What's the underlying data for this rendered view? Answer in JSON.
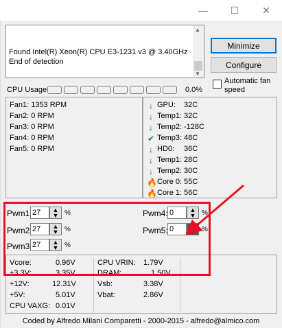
{
  "window": {
    "minimize_glyph": "—",
    "maximize_glyph": "☐",
    "close_glyph": "✕"
  },
  "log": {
    "lines": [
      "Found Intel(R) Xeon(R) CPU E3-1231 v3 @ 3.40GHz",
      "End of detection"
    ]
  },
  "buttons": {
    "minimize": "Minimize",
    "configure": "Configure"
  },
  "auto_fan": {
    "label": "Automatic fan speed",
    "checked": false
  },
  "cpu_usage": {
    "label": "CPU Usage",
    "value": "0.0%"
  },
  "fans": [
    {
      "label": "Fan1:",
      "value": "1353 RPM"
    },
    {
      "label": "Fan2:",
      "value": "0 RPM"
    },
    {
      "label": "Fan3:",
      "value": "0 RPM"
    },
    {
      "label": "Fan4:",
      "value": "0 RPM"
    },
    {
      "label": "Fan5:",
      "value": "0 RPM"
    }
  ],
  "temps": [
    {
      "icon": "down-arrow-icon",
      "label": "GPU:",
      "value": "32C"
    },
    {
      "icon": "down-arrow-icon",
      "label": "Temp1:",
      "value": "32C"
    },
    {
      "icon": "down-arrow-icon",
      "label": "Temp2:",
      "value": "-128C"
    },
    {
      "icon": "checkmark-icon",
      "label": "Temp3:",
      "value": "48C"
    },
    {
      "icon": "down-arrow-icon",
      "label": "HD0:",
      "value": "36C"
    },
    {
      "icon": "down-arrow-icon",
      "label": "Temp1:",
      "value": "28C"
    },
    {
      "icon": "down-arrow-icon",
      "label": "Temp2:",
      "value": "30C"
    },
    {
      "icon": "flame-icon",
      "label": "Core 0:",
      "value": "55C"
    },
    {
      "icon": "flame-icon",
      "label": "Core 1:",
      "value": "56C"
    }
  ],
  "pwm": [
    {
      "label": "Pwm1:",
      "value": "27",
      "unit": "%"
    },
    {
      "label": "Pwm2:",
      "value": "27",
      "unit": "%"
    },
    {
      "label": "Pwm3:",
      "value": "27",
      "unit": "%"
    },
    {
      "label": "Pwm4:",
      "value": "0",
      "unit": "%"
    },
    {
      "label": "Pwm5:",
      "value": "0",
      "unit": "%"
    }
  ],
  "voltages_left": [
    {
      "label": "Vcore:",
      "value": "0.96V"
    },
    {
      "label": "+3.3V:",
      "value": "3.35V"
    },
    {
      "label": "+12V:",
      "value": "12.31V"
    },
    {
      "label": "+5V:",
      "value": "5.01V"
    },
    {
      "label": "CPU VAXG:",
      "value": "0.01V"
    }
  ],
  "voltages_right": [
    {
      "label": "CPU VRIN:",
      "value": "1.79V"
    },
    {
      "label": "DRAM:",
      "value": "1.50V"
    },
    {
      "label": "Vsb:",
      "value": "3.38V"
    },
    {
      "label": "Vbat:",
      "value": "2.86V"
    }
  ],
  "footer": "Coded by Alfredo Milani Comparetti - 2000-2015 - alfredo@almico.com",
  "colors": {
    "highlight": "#e81123",
    "arrow_blue": "#1f4fbf",
    "check_green": "#1a8a1a",
    "flame": "#e8590c"
  }
}
